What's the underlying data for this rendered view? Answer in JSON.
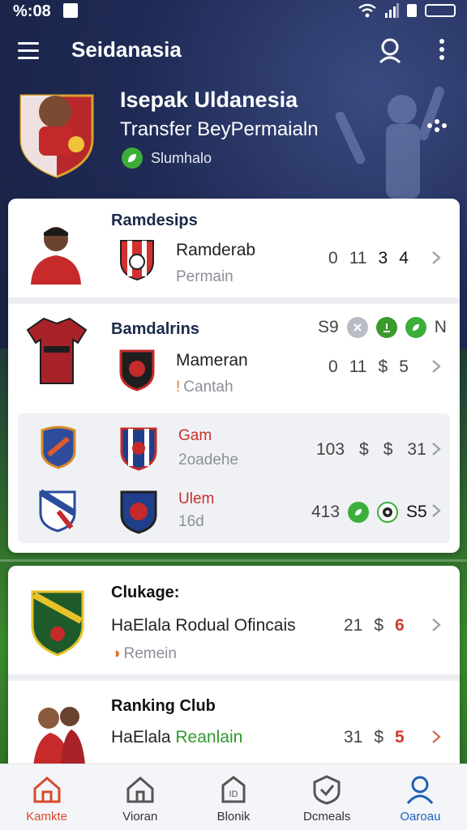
{
  "status_bar": {
    "time": "%:08"
  },
  "app_bar": {
    "title": "Seidanasia"
  },
  "header": {
    "title": "Isepak Uldanesia",
    "subtitle": "Transfer BeyPermaialn",
    "status_label": "Slumhalo"
  },
  "card_one": {
    "rows": [
      {
        "heading": "Ramdesips",
        "name": "Ramderab",
        "meta": "Permain",
        "stats": [
          "0",
          "11",
          "3",
          "4"
        ]
      },
      {
        "heading": "Bamdalrins",
        "name": "Mameran",
        "meta": "Cantah",
        "top_stats": [
          "S9",
          "N"
        ],
        "stats": [
          "0",
          "11",
          "$",
          "5"
        ]
      },
      {
        "name": "Gam",
        "meta": "2oadehe",
        "stats": [
          "103",
          "$",
          "$",
          "31"
        ]
      },
      {
        "name": "Ulem",
        "meta": "16d",
        "stats": [
          "413",
          "S5"
        ]
      }
    ]
  },
  "card_two": {
    "rows": [
      {
        "heading": "Clukage:",
        "name": "HaElala Rodual Ofincais",
        "meta": "Remein",
        "stats": [
          "21",
          "$",
          "6"
        ]
      },
      {
        "heading": "Ranking Club",
        "name": "HaElala",
        "name_highlight": "Reanlain",
        "stats": [
          "31",
          "$",
          "5"
        ]
      }
    ]
  },
  "bottom_nav": [
    {
      "label": "Kamkte",
      "icon": "home-icon"
    },
    {
      "label": "Vioran",
      "icon": "house-outline-icon"
    },
    {
      "label": "Blonik",
      "icon": "tag-house-icon"
    },
    {
      "label": "Dcmeals",
      "icon": "shield-check-icon"
    },
    {
      "label": "Oaroau",
      "icon": "user-icon"
    }
  ],
  "colors": {
    "accent_red": "#d43a2f",
    "accent_green": "#3cae3a",
    "accent_blue": "#1e5fb8",
    "header_bg": "#1f2a55"
  }
}
